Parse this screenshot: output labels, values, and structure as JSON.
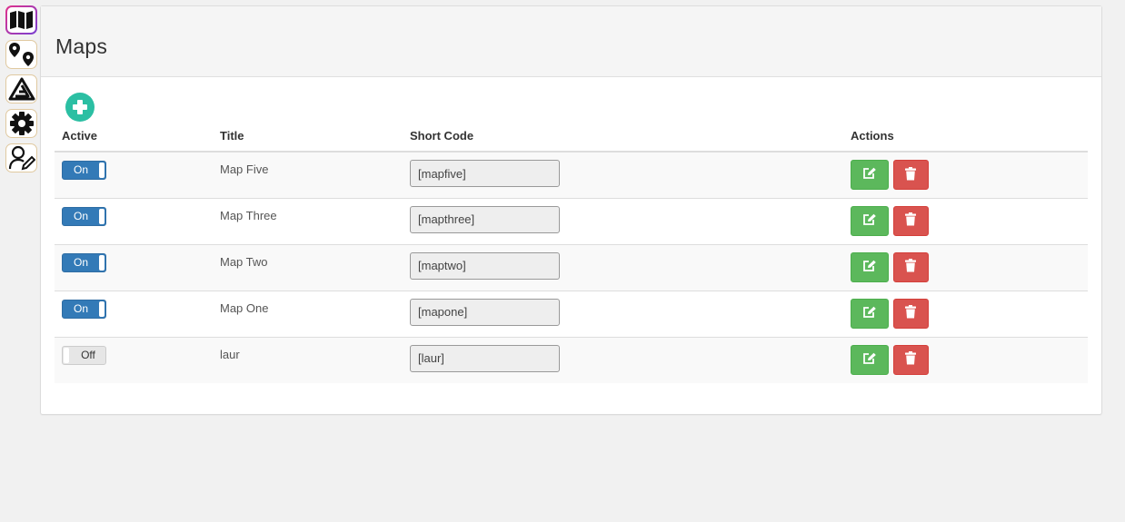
{
  "rail": [
    {
      "name": "map-icon",
      "active": true
    },
    {
      "name": "location-pins-icon",
      "active": false
    },
    {
      "name": "triangle-logo-icon",
      "active": false
    },
    {
      "name": "gear-icon",
      "active": false
    },
    {
      "name": "user-edit-icon",
      "active": false
    }
  ],
  "page": {
    "title": "Maps",
    "add_icon": "plus-circle-icon"
  },
  "table": {
    "headers": [
      "Active",
      "Title",
      "Short Code",
      "Actions"
    ],
    "rows": [
      {
        "active": true,
        "toggle_label": "On",
        "title": "Map Five",
        "shortcode": "[mapfive]"
      },
      {
        "active": true,
        "toggle_label": "On",
        "title": "Map Three",
        "shortcode": "[mapthree]"
      },
      {
        "active": true,
        "toggle_label": "On",
        "title": "Map Two",
        "shortcode": "[maptwo]"
      },
      {
        "active": true,
        "toggle_label": "On",
        "title": "Map One",
        "shortcode": "[mapone]"
      },
      {
        "active": false,
        "toggle_label": "Off",
        "title": "laur",
        "shortcode": "[laur]"
      }
    ],
    "edit_icon": "edit-icon",
    "delete_icon": "trash-icon"
  },
  "colors": {
    "toggle_on": "#337ab7",
    "edit": "#5cb85c",
    "delete": "#d9534f",
    "add": "#2bbfa3"
  }
}
